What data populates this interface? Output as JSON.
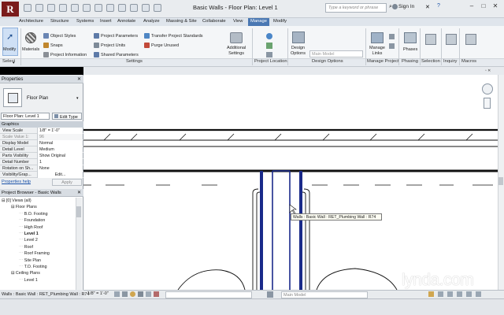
{
  "title": "Basic Walls - Floor Plan: Level 1",
  "search": {
    "placeholder": "Type a keyword or phrase"
  },
  "signin": "Sign In",
  "tabs": [
    "Architecture",
    "Structure",
    "Systems",
    "Insert",
    "Annotate",
    "Analyze",
    "Massing & Site",
    "Collaborate",
    "View",
    "Manage",
    "Modify"
  ],
  "active_tab": "Manage",
  "ribbon": {
    "select_label": "Select",
    "modify": "Modify",
    "materials": "Materials",
    "settings_items": {
      "object_styles": "Object Styles",
      "snaps": "Snaps",
      "project_information": "Project Information",
      "project_parameters": "Project Parameters",
      "project_units": "Project Units",
      "shared_parameters": "Shared Parameters",
      "transfer_project_standards": "Transfer Project Standards",
      "purge_unused": "Purge Unused",
      "additional_settings_1": "Additional",
      "additional_settings_2": "Settings"
    },
    "design_options_1": "Design",
    "design_options_2": "Options",
    "design_options_dropdown": "Main Model",
    "manage_links_1": "Manage",
    "manage_links_2": "Links",
    "phases": "Phases",
    "panels": [
      "Settings",
      "Project Location",
      "Design Options",
      "Manage Project",
      "Phasing",
      "Selection",
      "Inquiry",
      "Macros"
    ]
  },
  "properties": {
    "title": "Properties",
    "type_name": "Floor Plan",
    "type_selector": "Floor Plan: Level 1",
    "edit_type": "Edit Type",
    "group": "Graphics",
    "rows": [
      {
        "key": "View Scale",
        "value": "1/8\" = 1'-0\""
      },
      {
        "key": "Scale Value    1:",
        "value": "96"
      },
      {
        "key": "Display Model",
        "value": "Normal"
      },
      {
        "key": "Detail Level",
        "value": "Medium"
      },
      {
        "key": "Parts Visibility",
        "value": "Show Original"
      },
      {
        "key": "Detail Number",
        "value": "1"
      },
      {
        "key": "Rotation on Sh...",
        "value": "None"
      },
      {
        "key": "Visibility/Grap...",
        "value": "Edit..."
      }
    ],
    "help": "Properties help",
    "apply": "Apply"
  },
  "browser": {
    "title": "Project Browser - Basic Walls",
    "items": [
      {
        "label": "[0] Views (all)",
        "depth": 0,
        "bold": false
      },
      {
        "label": "Floor Plans",
        "depth": 1,
        "bold": false
      },
      {
        "label": "B.O. Footing",
        "depth": 2,
        "bold": false
      },
      {
        "label": "Foundation",
        "depth": 2,
        "bold": false
      },
      {
        "label": "High Roof",
        "depth": 2,
        "bold": false
      },
      {
        "label": "Level 1",
        "depth": 2,
        "bold": true
      },
      {
        "label": "Level 2",
        "depth": 2,
        "bold": false
      },
      {
        "label": "Roof",
        "depth": 2,
        "bold": false
      },
      {
        "label": "Roof Framing",
        "depth": 2,
        "bold": false
      },
      {
        "label": "Site Plan",
        "depth": 2,
        "bold": false
      },
      {
        "label": "T.O. Footing",
        "depth": 2,
        "bold": false
      },
      {
        "label": "Ceiling Plans",
        "depth": 1,
        "bold": false
      },
      {
        "label": "Level 1",
        "depth": 2,
        "bold": false
      }
    ]
  },
  "tooltip": "Walls : Basic Wall : RET_Plumbing Wall : R74",
  "view_scale": "1/8\" = 1'-0\"",
  "status": {
    "text": "Walls : Basic Wall : RET_Plumbing Wall : R74",
    "main_model": "Main Model"
  },
  "watermark": "lynda.com",
  "colors": {
    "active_tab": "#4a78b3",
    "wall_fill": "#1a2a8a",
    "link": "#1a52a8"
  }
}
